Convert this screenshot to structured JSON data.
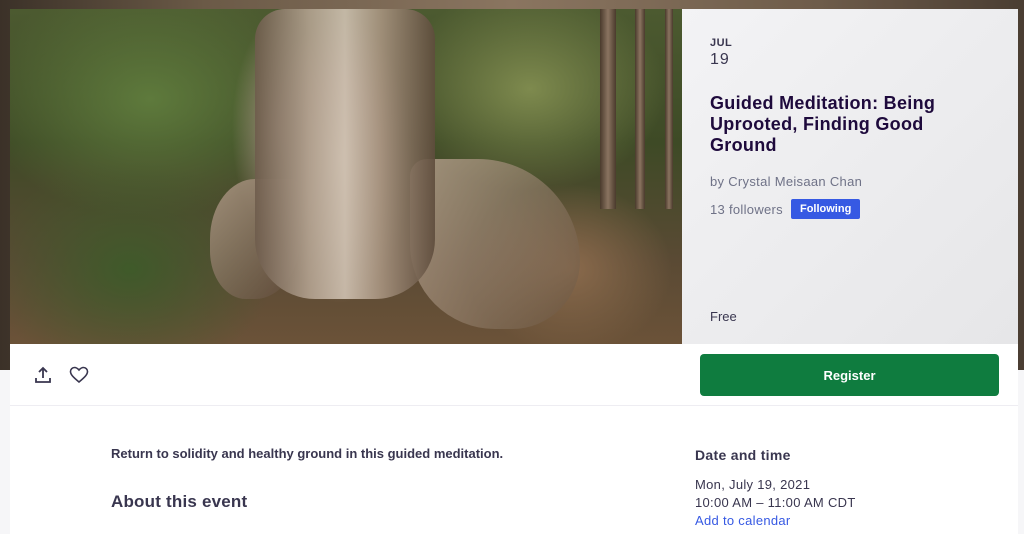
{
  "event": {
    "month": "JUL",
    "day": "19",
    "title": "Guided Meditation: Being Uprooted, Finding Good Ground",
    "organizer": "by Crystal Meisaan Chan",
    "followers": "13 followers",
    "follow_label": "Following",
    "price": "Free"
  },
  "actions": {
    "share_icon": "share-icon",
    "like_icon": "heart-icon",
    "register_label": "Register"
  },
  "content": {
    "summary": "Return to solidity and healthy ground in this guided meditation.",
    "about_heading": "About this event"
  },
  "date_time": {
    "heading": "Date and time",
    "date": "Mon, July 19, 2021",
    "time": "10:00 AM – 11:00 AM CDT",
    "add_to_calendar": "Add to calendar"
  },
  "colors": {
    "register": "#0f7c3f",
    "follow_badge": "#3659e3",
    "title": "#1e0a3c",
    "link": "#3659e3"
  }
}
